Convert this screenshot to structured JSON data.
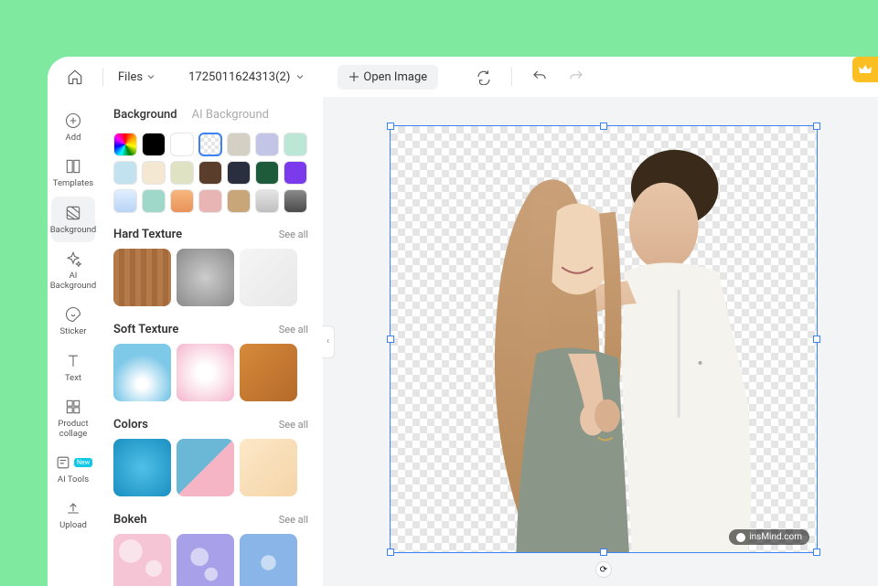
{
  "topbar": {
    "files_label": "Files",
    "filename": "1725011624313(2)",
    "open_image_label": "Open Image"
  },
  "sidebar": {
    "items": [
      {
        "label": "Add"
      },
      {
        "label": "Templates"
      },
      {
        "label": "Background"
      },
      {
        "label": "AI Background"
      },
      {
        "label": "Sticker"
      },
      {
        "label": "Text"
      },
      {
        "label": "Product collage"
      },
      {
        "label": "AI Tools",
        "new_badge": "New"
      },
      {
        "label": "Upload"
      }
    ]
  },
  "panel": {
    "tabs": {
      "background": "Background",
      "ai": "AI Background"
    },
    "swatch_colors": [
      "rainbow",
      "#000000",
      "#ffffff",
      "transparent",
      "#d4d0c4",
      "#c3c5e6",
      "#bce7d6",
      "#c3e2ef",
      "#f5e8d3",
      "#dfe3c4",
      "#5a3d2b",
      "#2a2f3f",
      "#1e5b3a",
      "#7c3aed",
      "grad-blue",
      "#9fd8c8",
      "#f3a06b",
      "#e8b4b4",
      "#c9a57a",
      "#bfbfbf",
      "#5a5a5a"
    ],
    "selected_swatch_index": 3,
    "sections": {
      "hard_texture": {
        "title": "Hard Texture",
        "see_all": "See all",
        "thumbs": [
          "wood",
          "concrete",
          "marble"
        ]
      },
      "soft_texture": {
        "title": "Soft Texture",
        "see_all": "See all",
        "thumbs": [
          "water",
          "pink-silk",
          "leather"
        ]
      },
      "colors": {
        "title": "Colors",
        "see_all": "See all",
        "thumbs": [
          "blue-grad",
          "pink-blue-diag",
          "peach"
        ]
      },
      "bokeh": {
        "title": "Bokeh",
        "see_all": "See all",
        "thumbs": [
          "pink-bokeh",
          "purple-bokeh",
          "blue-bokeh"
        ]
      }
    }
  },
  "canvas": {
    "watermark": "insMind.com"
  }
}
